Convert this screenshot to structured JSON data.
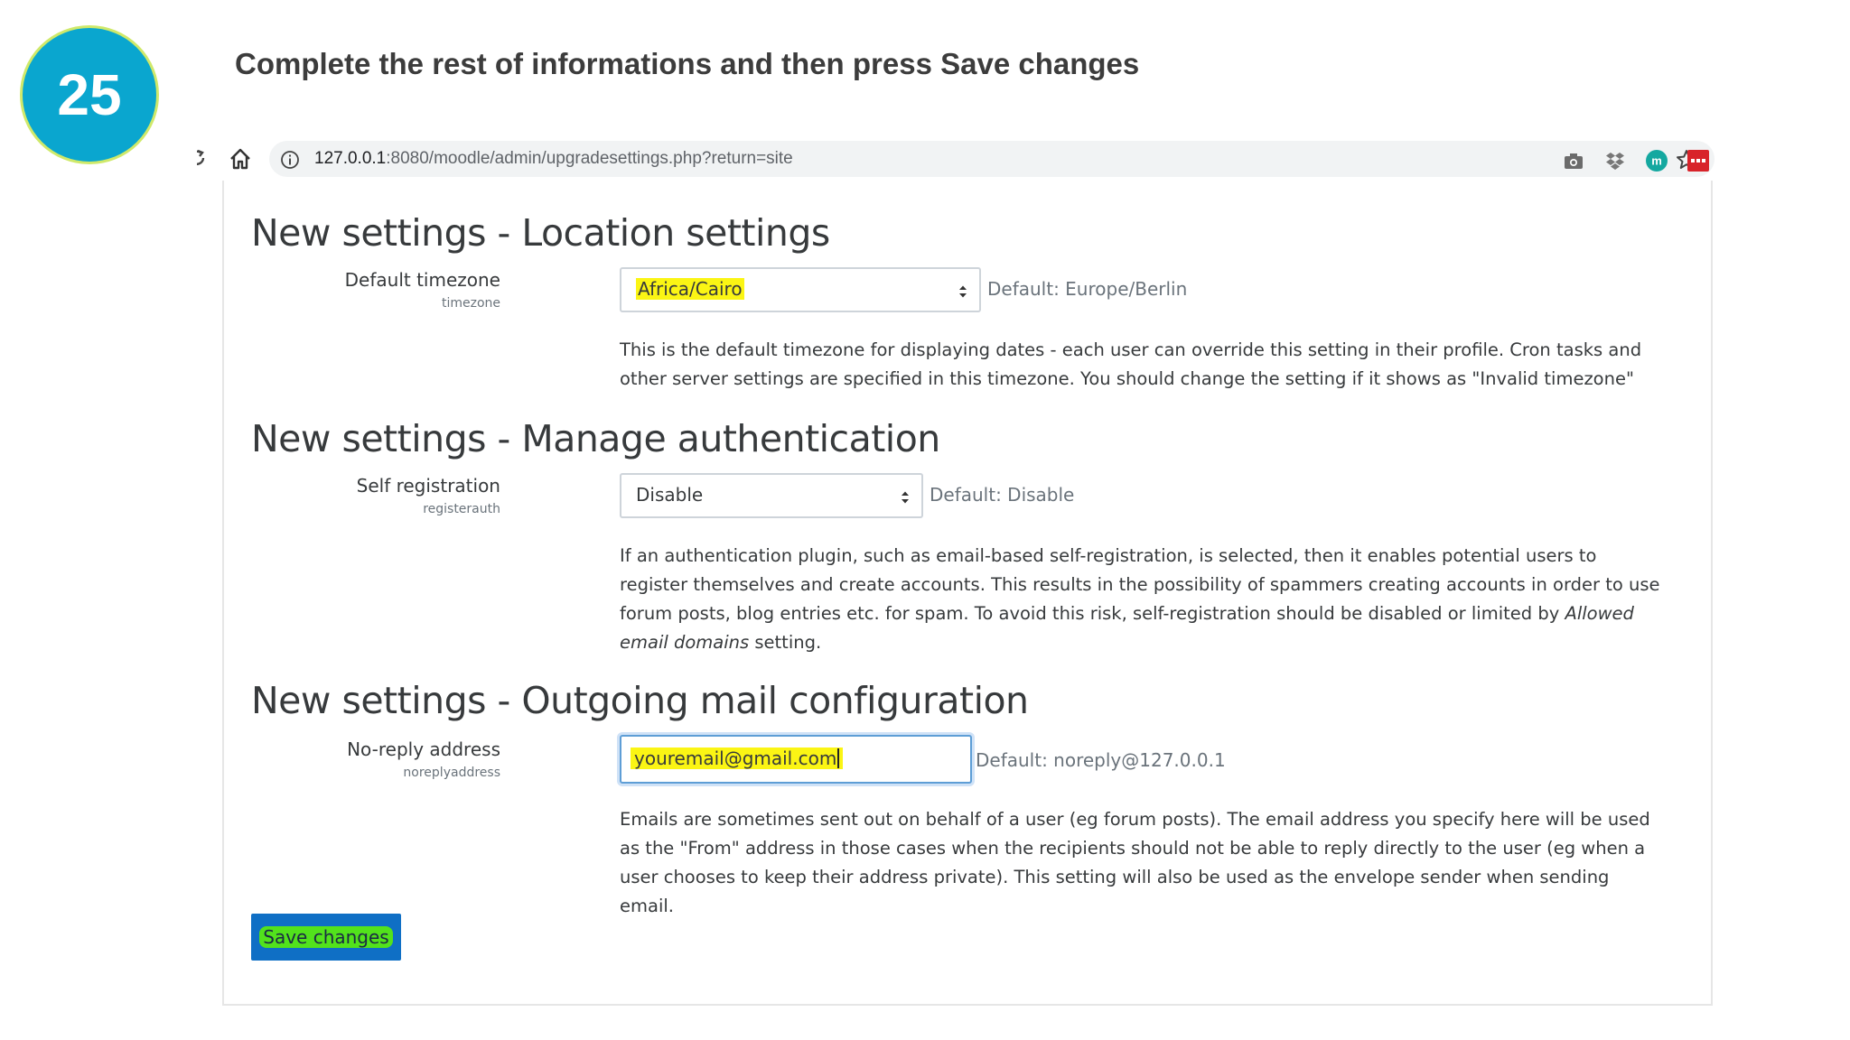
{
  "slide": {
    "step_number": "25",
    "title": "Complete the rest of informations and then press Save changes"
  },
  "browser": {
    "url_host": "127.0.0.1",
    "url_rest": ":8080/moodle/admin/upgradesettings.php?return=site",
    "extension_icons": [
      "camera-icon",
      "dropbox-icon",
      "moodle-extension-icon",
      "red-extension-icon"
    ]
  },
  "sections": {
    "location": {
      "heading": "New settings - Location settings",
      "setting_name": "Default timezone",
      "setting_key": "timezone",
      "selected_value": "Africa/Cairo",
      "default": "Default: Europe/Berlin",
      "description": "This is the default timezone for displaying dates - each user can override this setting in their profile. Cron tasks and other server settings are specified in this timezone. You should change the setting if it shows as \"Invalid timezone\""
    },
    "authentication": {
      "heading": "New settings - Manage authentication",
      "setting_name": "Self registration",
      "setting_key": "registerauth",
      "selected_value": "Disable",
      "default": "Default: Disable",
      "description_part1": "If an authentication plugin, such as email-based self-registration, is selected, then it enables potential users to register themselves and create accounts. This results in the possibility of spammers creating accounts in order to use forum posts, blog entries etc. for spam. To avoid this risk, self-registration should be disabled or limited by ",
      "description_emphasis": "Allowed email domains",
      "description_part2": " setting."
    },
    "mail": {
      "heading": "New settings - Outgoing mail configuration",
      "setting_name": "No-reply address",
      "setting_key": "noreplyaddress",
      "input_value": "youremail@gmail.com",
      "default": "Default: noreply@127.0.0.1",
      "description": "Emails are sometimes sent out on behalf of a user (eg forum posts). The email address you specify here will be used as the \"From\" address in those cases when the recipients should not be able to reply directly to the user (eg when a user chooses to keep their address private). This setting will also be used as the envelope sender when sending email."
    }
  },
  "save_button_label": "Save changes",
  "colors": {
    "badge": "#0aa6cf",
    "highlight": "#fbf514",
    "button": "#0f6fc5",
    "button_highlight": "#52e21c"
  }
}
